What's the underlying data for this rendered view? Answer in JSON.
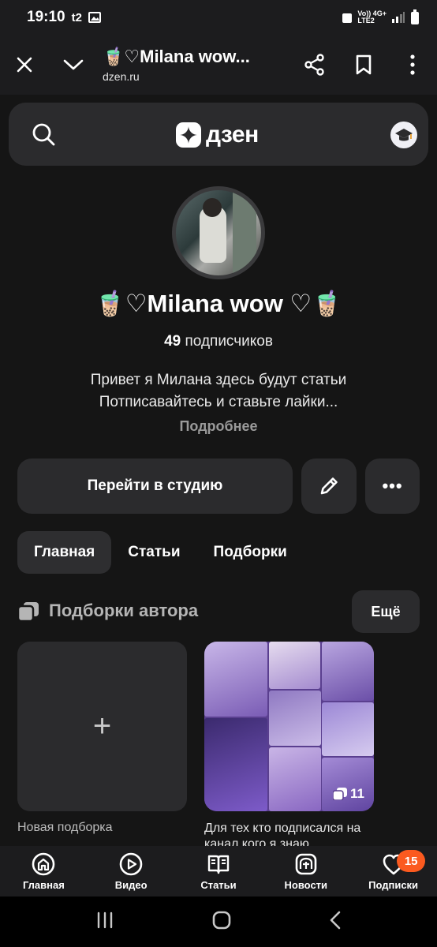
{
  "status_bar": {
    "time": "19:10",
    "carrier_icon": "t2",
    "network_text": "Vo)) 4G+",
    "network_text2": "LTE2"
  },
  "browser": {
    "title": "🧋♡Milana wow...",
    "url": "dzen.ru"
  },
  "header": {
    "logo_text": "дзен"
  },
  "profile": {
    "name": "🧋♡Milana wow ♡🧋",
    "subscribers_count": "49",
    "subscribers_label": "подписчиков",
    "description_line1": "Привет я Милана здесь будут статьи",
    "description_line2": "Потписавайтесь и ставьте лайки...",
    "more_link": "Подробнее"
  },
  "actions": {
    "studio_label": "Перейти в студию",
    "more_label": "•••"
  },
  "tabs": [
    {
      "label": "Главная",
      "active": true
    },
    {
      "label": "Статьи",
      "active": false
    },
    {
      "label": "Подборки",
      "active": false
    }
  ],
  "collections": {
    "title": "Подборки автора",
    "more_label": "Ещё",
    "new_plus": "+",
    "new_label": "Новая подборка",
    "card_count": "11",
    "card_label": "Для тех кто подписался на канал кого я знаю"
  },
  "bottom_nav": [
    {
      "label": "Главная",
      "icon": "home-icon"
    },
    {
      "label": "Видео",
      "icon": "video-icon"
    },
    {
      "label": "Статьи",
      "icon": "articles-icon"
    },
    {
      "label": "Новости",
      "icon": "news-icon"
    },
    {
      "label": "Подписки",
      "icon": "subscriptions-icon",
      "badge": "15"
    }
  ],
  "colors": {
    "badge": "#fb5a1f",
    "surface": "#2b2b2d",
    "page_bg": "#151515"
  }
}
